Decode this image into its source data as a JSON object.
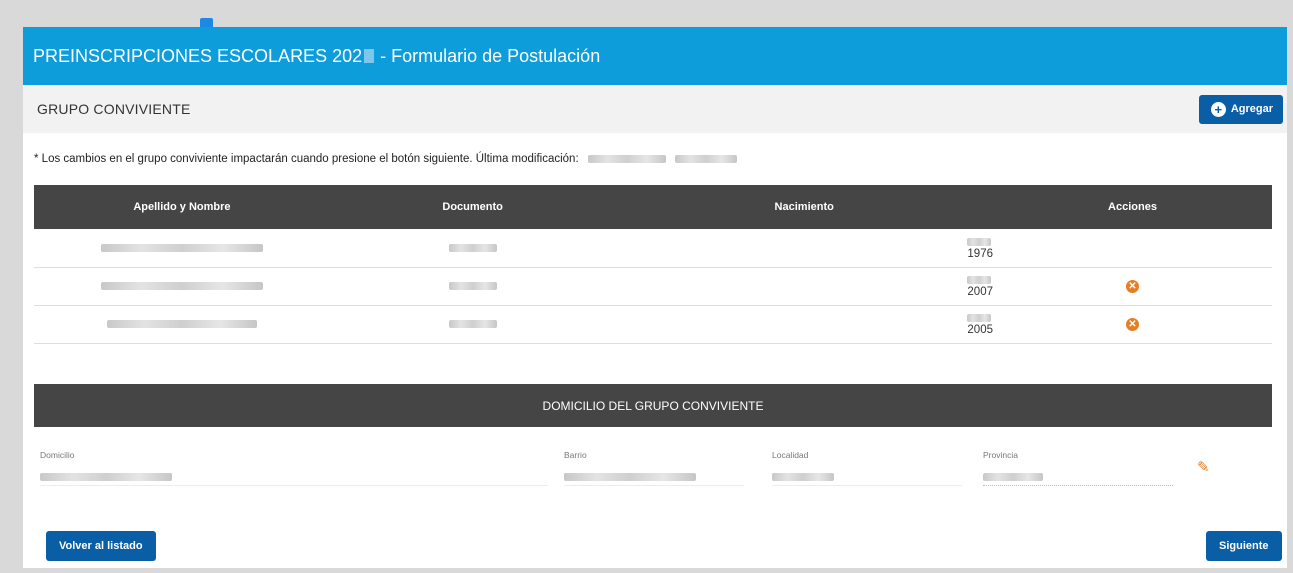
{
  "header": {
    "title_pre": "PREINSCRIPCIONES ESCOLARES 202",
    "title_post": "- Formulario de Postulación"
  },
  "section": {
    "title": "GRUPO CONVIVIENTE",
    "add_label": "Agregar"
  },
  "note": "* Los cambios en el grupo conviviente impactarán cuando presione el botón siguiente. Última modificación:",
  "table": {
    "columns": [
      "Apellido y Nombre",
      "Documento",
      "Nacimiento",
      "Acciones"
    ],
    "rows": [
      {
        "birth_year": "1976",
        "removable": false
      },
      {
        "birth_year": "2007",
        "removable": true
      },
      {
        "birth_year": "2005",
        "removable": true
      }
    ]
  },
  "address": {
    "title": "DOMICILIO DEL GRUPO CONVIVIENTE",
    "fields": {
      "domicilio": "Domicilio",
      "barrio": "Barrio",
      "localidad": "Localidad",
      "provincia": "Provincia"
    }
  },
  "footer": {
    "back_label": "Volver al listado",
    "next_label": "Siguiente"
  },
  "colors": {
    "title_bar": "#0d9ddb",
    "button": "#0a5ea6",
    "table_header": "#454545",
    "action": "#e67e22"
  },
  "icons": {
    "add": "plus-circle-icon",
    "remove": "x-circle-icon",
    "edit": "pencil-icon"
  }
}
